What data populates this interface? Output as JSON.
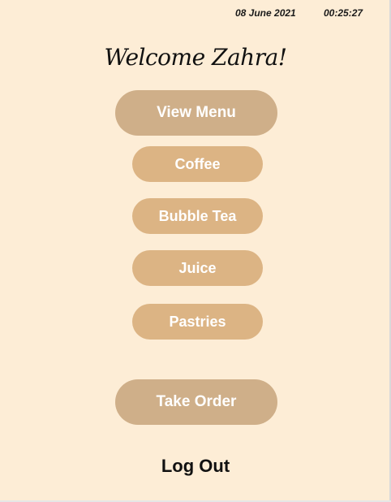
{
  "status": {
    "date": "08 June 2021",
    "time": "00:25:27"
  },
  "greeting": "Welcome Zahra!",
  "view_menu_label": "View Menu",
  "menu_items": [
    {
      "label": "Coffee"
    },
    {
      "label": "Bubble Tea"
    },
    {
      "label": "Juice"
    },
    {
      "label": "Pastries"
    }
  ],
  "take_order_label": "Take Order",
  "logout_label": "Log Out",
  "colors": {
    "background": "#fdedd6",
    "primary_button": "#cfaf89",
    "menu_button": "#dcb484",
    "button_text": "#ffffff"
  }
}
